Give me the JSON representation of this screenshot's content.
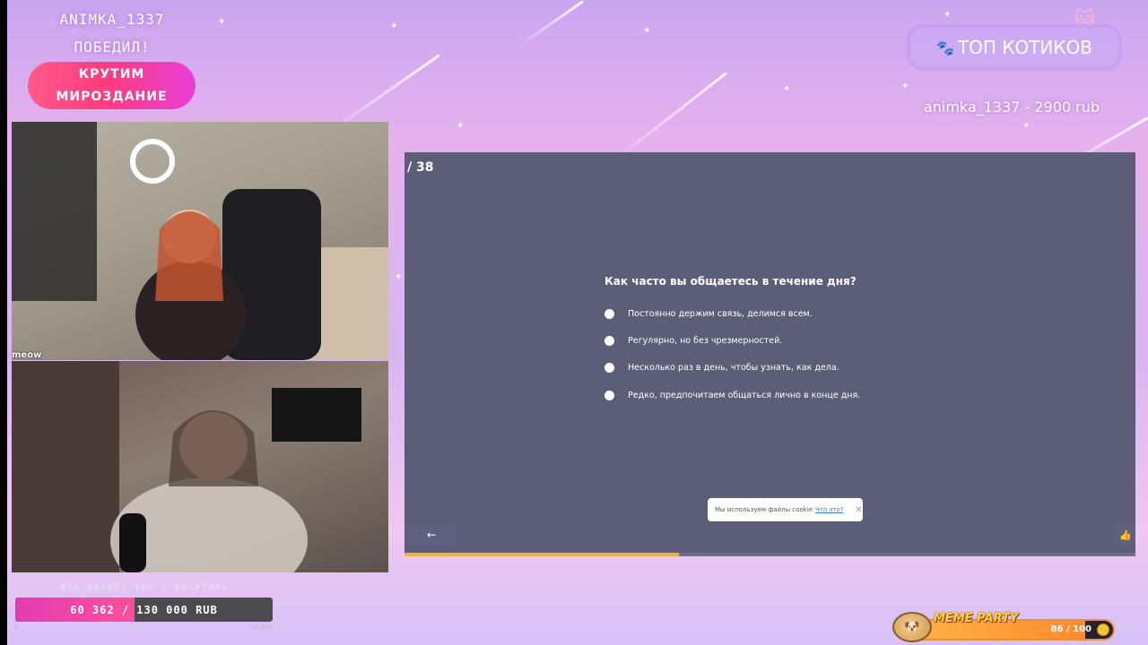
{
  "overlay": {
    "winner_line1": "ANIMKA_1337",
    "winner_line2": "ПОБЕДИЛ!",
    "pill_line1": "КРУТИМ",
    "pill_line2": "МИРОЗДАНИЕ",
    "top_cats_label": "ТОП КОТИКОВ",
    "top_donor": "animka_1337 - 2900 rub",
    "accent_pink": "#ff3c7e",
    "accent_purple": "#e63fd6"
  },
  "webcams": {
    "cam1_label": "meow"
  },
  "quiz": {
    "counter": "/ 38",
    "question": "Как часто вы общаетесь в течение дня?",
    "options": [
      "Постоянно держим связь, делимся всем.",
      "Регулярно, но без чрезмерностей.",
      "Несколько раз в день, чтобы узнать, как дела.",
      "Редко, предпочитаем общаться лично в конце дня."
    ],
    "cookie_text": "Мы используем файлы cookie",
    "cookie_link": "Что это?",
    "cookie_close": "✕",
    "back_icon": "←",
    "like_icon": "👍",
    "progress": 0.375,
    "progress_color": "#f1b23a",
    "panel_color": "#5c5e78"
  },
  "goal": {
    "title": "RTX 5070TI 16G + КВАРТИРА",
    "current": 60362,
    "target": 130000,
    "text": "60 362 / 130 000 RUB",
    "min_label": "0",
    "max_label": "130 000"
  },
  "meme_party": {
    "title": "MEME PARTY",
    "count_text": "86 / 100",
    "value": 86,
    "max": 100
  }
}
